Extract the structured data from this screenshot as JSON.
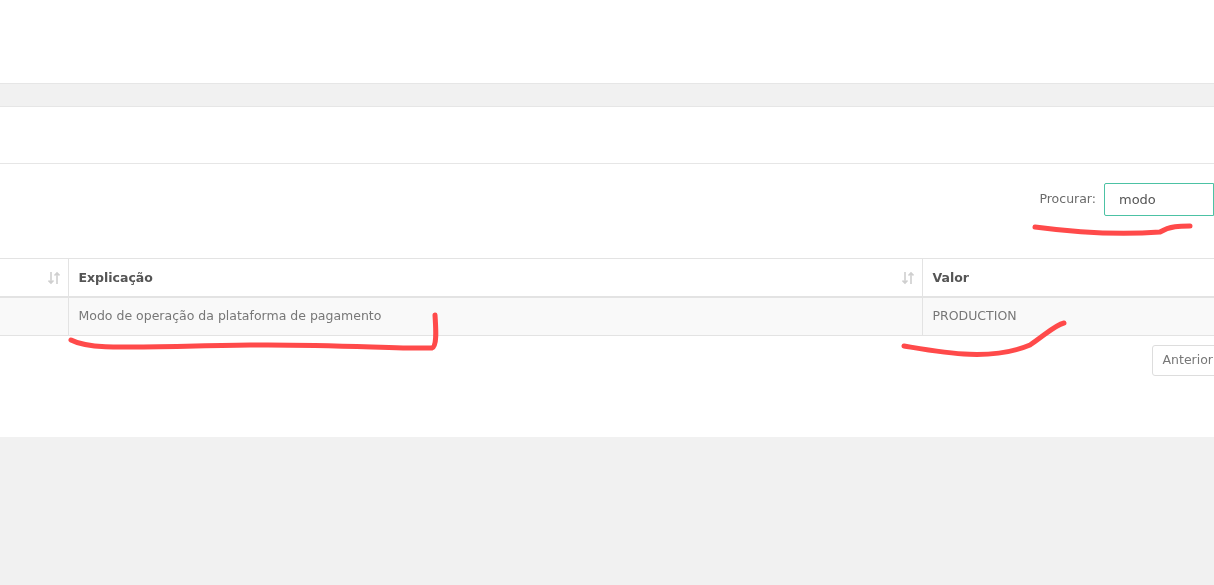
{
  "search": {
    "label": "Procurar:",
    "value": "modo"
  },
  "table": {
    "columns": [
      {
        "sortable": true
      },
      {
        "label": "Explicação",
        "sortable": true
      },
      {
        "label": "Valor",
        "sortable": false
      }
    ],
    "rows": [
      {
        "cells": [
          "",
          "Modo de operação da plataforma de pagamento",
          "PRODUCTION"
        ]
      }
    ]
  },
  "pagination": [
    "Anterior"
  ]
}
